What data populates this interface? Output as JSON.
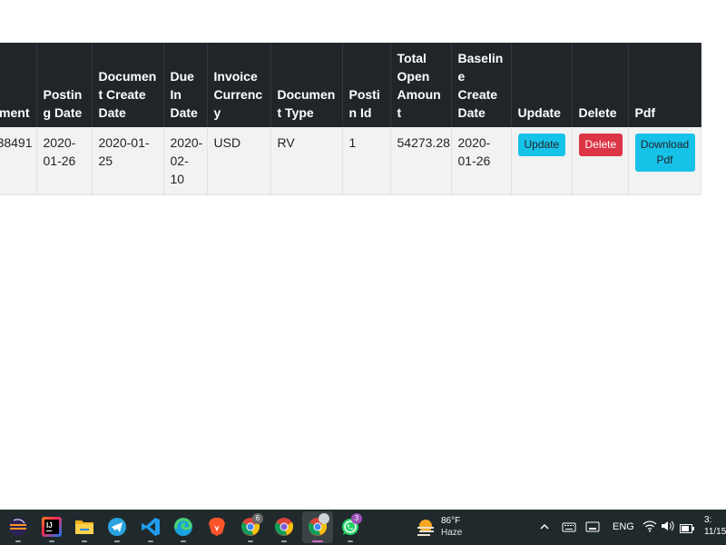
{
  "table": {
    "headers": [
      "Document Id",
      "Posting Date",
      "Document Create Date",
      "Due In Date",
      "Invoice Currency",
      "Document Type",
      "Posting Id",
      "Total Open Amount",
      "Baseline Create Date",
      "Update",
      "Delete",
      "Pdf"
    ],
    "headers_visible": [
      "ment",
      "Posting Date",
      "Document Create Date",
      "Due In Date",
      "Invoice Currency",
      "Document Type",
      "Postin Id",
      "Total Open Amount",
      "Baseline Create Date",
      "Update",
      "Delete",
      "Pdf"
    ],
    "row": {
      "doc_id_visible": "38491",
      "posting_date": "2020-01-26",
      "document_create_date": "2020-01-25",
      "due_in_date": "2020-02-10",
      "invoice_currency": "USD",
      "document_type": "RV",
      "posting_id": "1",
      "total_open_amount": "54273.28",
      "baseline_create_date": "2020-01-26",
      "update_label": "Update",
      "delete_label": "Delete",
      "pdf_label": "Download Pdf"
    }
  },
  "taskbar": {
    "icons": [
      "eclipse-icon",
      "intellij-icon",
      "file-explorer-icon",
      "telegram-icon",
      "vscode-icon",
      "edge-icon",
      "brave-icon",
      "chrome-icon",
      "chrome-profile-icon",
      "chrome-active-icon",
      "whatsapp-icon"
    ],
    "chrome_badge": "6",
    "whatsapp_badge": "3",
    "weather": {
      "temp": "86°F",
      "condition": "Haze"
    },
    "language": "ENG",
    "clock_time": "3:",
    "clock_date": "11/15"
  },
  "colors": {
    "header_bg": "#212529",
    "row_bg": "#f2f2f2",
    "info": "#17c2e8",
    "danger": "#dc3545",
    "taskbar_bg": "#202a2c"
  }
}
